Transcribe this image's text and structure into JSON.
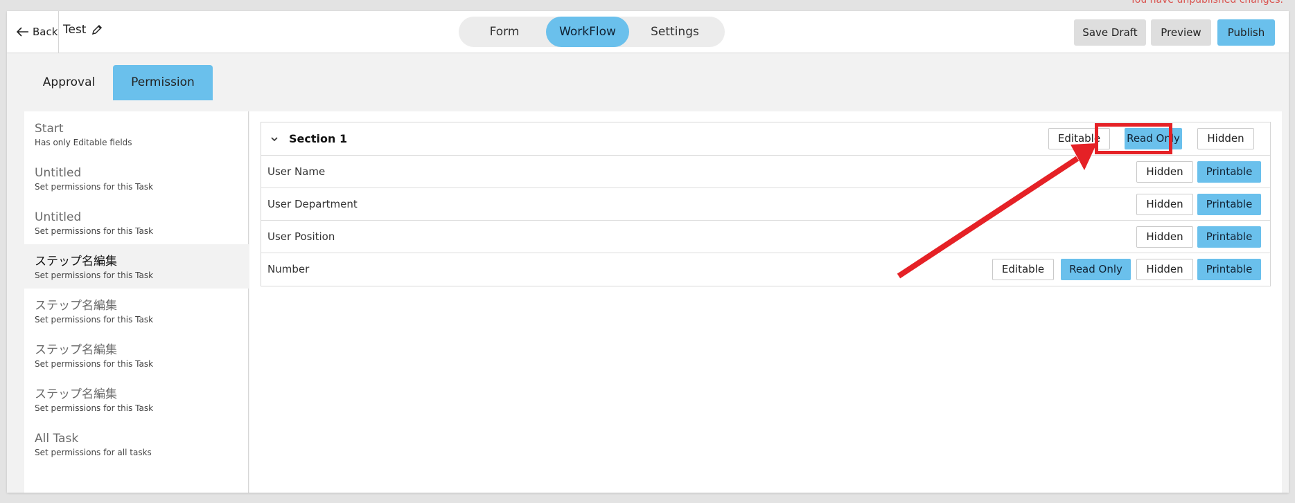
{
  "notice": "You have unpublished changes.",
  "header": {
    "back_label": "Back",
    "title": "Test",
    "tabs": [
      {
        "label": "Form",
        "active": false
      },
      {
        "label": "WorkFlow",
        "active": true
      },
      {
        "label": "Settings",
        "active": false
      }
    ],
    "save_draft": "Save Draft",
    "preview": "Preview",
    "publish": "Publish"
  },
  "subtabs": {
    "approval": "Approval",
    "permission": "Permission",
    "active": "Permission"
  },
  "sidebar": {
    "items": [
      {
        "title": "Start",
        "subtitle": "Has only Editable fields",
        "selected": false
      },
      {
        "title": "Untitled",
        "subtitle": "Set permissions for this Task",
        "selected": false
      },
      {
        "title": "Untitled",
        "subtitle": "Set permissions for this Task",
        "selected": false
      },
      {
        "title": "ステップ名編集",
        "subtitle": "Set permissions for this Task",
        "selected": true
      },
      {
        "title": "ステップ名編集",
        "subtitle": "Set permissions for this Task",
        "selected": false
      },
      {
        "title": "ステップ名編集",
        "subtitle": "Set permissions for this Task",
        "selected": false
      },
      {
        "title": "ステップ名編集",
        "subtitle": "Set permissions for this Task",
        "selected": false
      },
      {
        "title": "All Task",
        "subtitle": "Set permissions for all tasks",
        "selected": false
      }
    ]
  },
  "section": {
    "title": "Section 1",
    "editable": "Editable",
    "read_only": "Read Only",
    "hidden": "Hidden",
    "selected": "Read Only"
  },
  "fields": [
    {
      "label": "User Name",
      "hidden": "Hidden",
      "printable": "Printable"
    },
    {
      "label": "User Department",
      "hidden": "Hidden",
      "printable": "Printable"
    },
    {
      "label": "User Position",
      "hidden": "Hidden",
      "printable": "Printable"
    },
    {
      "label": "Number",
      "editable": "Editable",
      "read_only": "Read Only",
      "hidden": "Hidden",
      "printable": "Printable"
    }
  ],
  "colors": {
    "accent": "#6ac0ec",
    "annotation": "#e52126",
    "notice": "#d9534f"
  },
  "icons": {
    "back": "arrow-left-icon",
    "edit": "pencil-icon",
    "collapse": "chevron-down-icon"
  }
}
